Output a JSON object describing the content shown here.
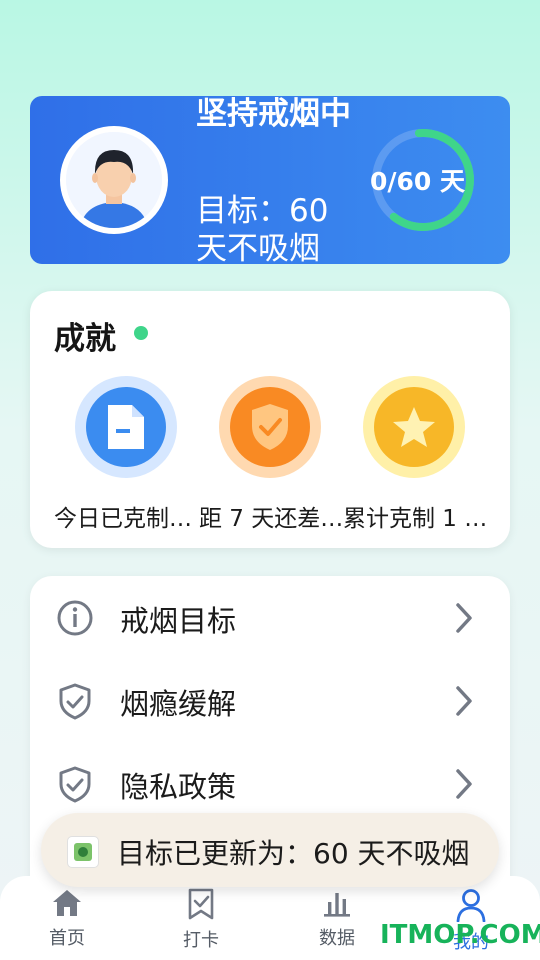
{
  "profile": {
    "status": "坚持戒烟中",
    "goal": "目标：60 天不吸烟",
    "progress_text": "0/60 天",
    "progress_fraction": 0.62,
    "avatar_icon": "user-avatar-icon"
  },
  "achievements": {
    "title": "成就",
    "items": [
      {
        "label": "今日已克制…",
        "icon": "document-icon",
        "color": "#3b8cf0"
      },
      {
        "label": "距 7 天还差…",
        "icon": "shield-check-icon",
        "color": "#f98a23"
      },
      {
        "label": "累计克制 1 …",
        "icon": "star-icon",
        "color": "#f7b728"
      }
    ]
  },
  "menu": {
    "items": [
      {
        "label": "戒烟目标",
        "icon": "info-icon"
      },
      {
        "label": "烟瘾缓解",
        "icon": "shield-check-icon"
      },
      {
        "label": "隐私政策",
        "icon": "shield-check-icon"
      }
    ]
  },
  "toast": {
    "text": "目标已更新为：60 天不吸烟"
  },
  "nav": {
    "items": [
      {
        "label": "首页",
        "icon": "home-icon"
      },
      {
        "label": "打卡",
        "icon": "checkin-icon"
      },
      {
        "label": "数据",
        "icon": "bar-chart-icon"
      },
      {
        "label": "我的",
        "icon": "person-icon"
      }
    ]
  },
  "watermark": "ITMOP.COM",
  "colors": {
    "accent": "#2f6fe8",
    "progress": "#3fd58a"
  }
}
